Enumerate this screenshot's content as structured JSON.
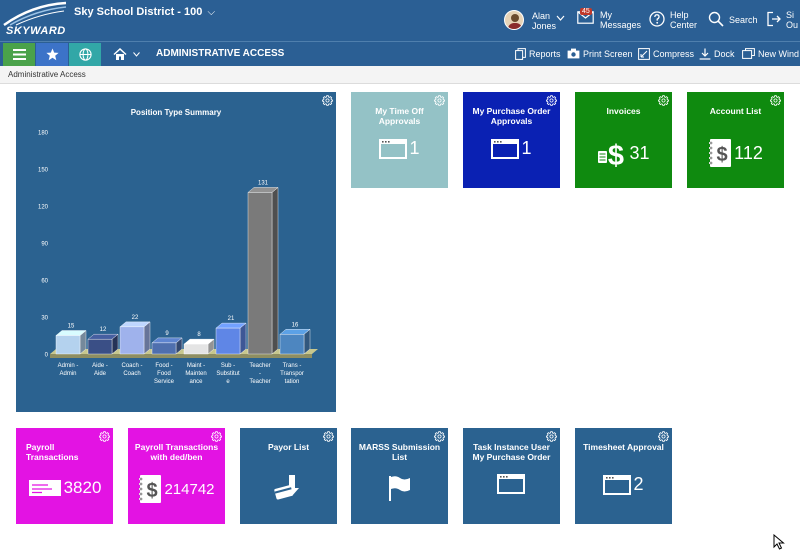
{
  "header": {
    "logo_text": "SKYWARD",
    "district": "Sky School District - 100",
    "user_first": "Alan",
    "user_last": "Jones",
    "messages_badge": "45",
    "messages_line1": "My",
    "messages_line2": "Messages",
    "help_line1": "Help",
    "help_line2": "Center",
    "search": "Search",
    "signout_line1": "Si",
    "signout_line2": "Ou"
  },
  "nav": {
    "title": "ADMINISTRATIVE ACCESS",
    "tools": {
      "reports": "Reports",
      "print_screen": "Print Screen",
      "compress": "Compress",
      "dock": "Dock",
      "new_window": "New Wind"
    }
  },
  "breadcrumb": "Administrative Access",
  "colors": {
    "header": "#2b5f94",
    "chart_tile": "#2b6290",
    "time_off": "#94c2c6",
    "purchase": "#0a21b3",
    "invoices": "#0f8a0f",
    "account": "#0f8a0f",
    "payroll": "#e313e3",
    "blue_tile": "#2b6290",
    "menu_green": "#4aa24a",
    "star_blue": "#3c73c8",
    "globe_teal": "#32a7a7"
  },
  "tiles": {
    "time_off": {
      "title": "My Time Off Approvals",
      "value": "1",
      "icon": "window-icon"
    },
    "purchase": {
      "title": "My Purchase Order Approvals",
      "value": "1",
      "icon": "window-icon"
    },
    "invoices": {
      "title": "Invoices",
      "value": "31",
      "icon": "invoice-dollar-icon"
    },
    "account": {
      "title": "Account List",
      "value": "112",
      "icon": "ledger-dollar-icon"
    },
    "payroll": {
      "title": "Payroll Transactions",
      "value": "3820",
      "icon": "check-icon"
    },
    "payroll_ded": {
      "title": "Payroll Transactions with ded/ben",
      "value": "214742",
      "icon": "ledger-dollar-icon"
    },
    "payor": {
      "title": "Payor List",
      "value": "",
      "icon": "card-arrow-icon"
    },
    "marss": {
      "title": "MARSS Submission List",
      "value": "",
      "icon": "flag-icon"
    },
    "task": {
      "title": "Task Instance User My Purchase Order",
      "value": "",
      "icon": "window-icon"
    },
    "timesheet": {
      "title": "Timesheet Approval",
      "value": "2",
      "icon": "window-icon"
    }
  },
  "chart_data": {
    "type": "bar",
    "title": "Position Type Summary",
    "categories": [
      [
        "Admin -",
        "Admin"
      ],
      [
        "Aide -",
        "Aide"
      ],
      [
        "Coach -",
        "Coach"
      ],
      [
        "Food -",
        "Food",
        "Service"
      ],
      [
        "Maint -",
        "Mainten",
        "ance"
      ],
      [
        "Sub -",
        "Substitut",
        "e"
      ],
      [
        "Teacher",
        "-",
        "Teacher"
      ],
      [
        "Trans -",
        "Transpor",
        "tation"
      ]
    ],
    "values": [
      15,
      12,
      22,
      9,
      8,
      21,
      131,
      16
    ],
    "bar_colors": [
      "#b4d2ee",
      "#3a4f86",
      "#9fb2ec",
      "#4f6fae",
      "#e4e4e4",
      "#5f86e6",
      "#7a7a7a",
      "#4d86c0"
    ],
    "yticks": [
      "0",
      "30",
      "60",
      "90",
      "120",
      "150",
      "180"
    ],
    "ylim": [
      0,
      180
    ],
    "grid": false,
    "legend": "none"
  }
}
